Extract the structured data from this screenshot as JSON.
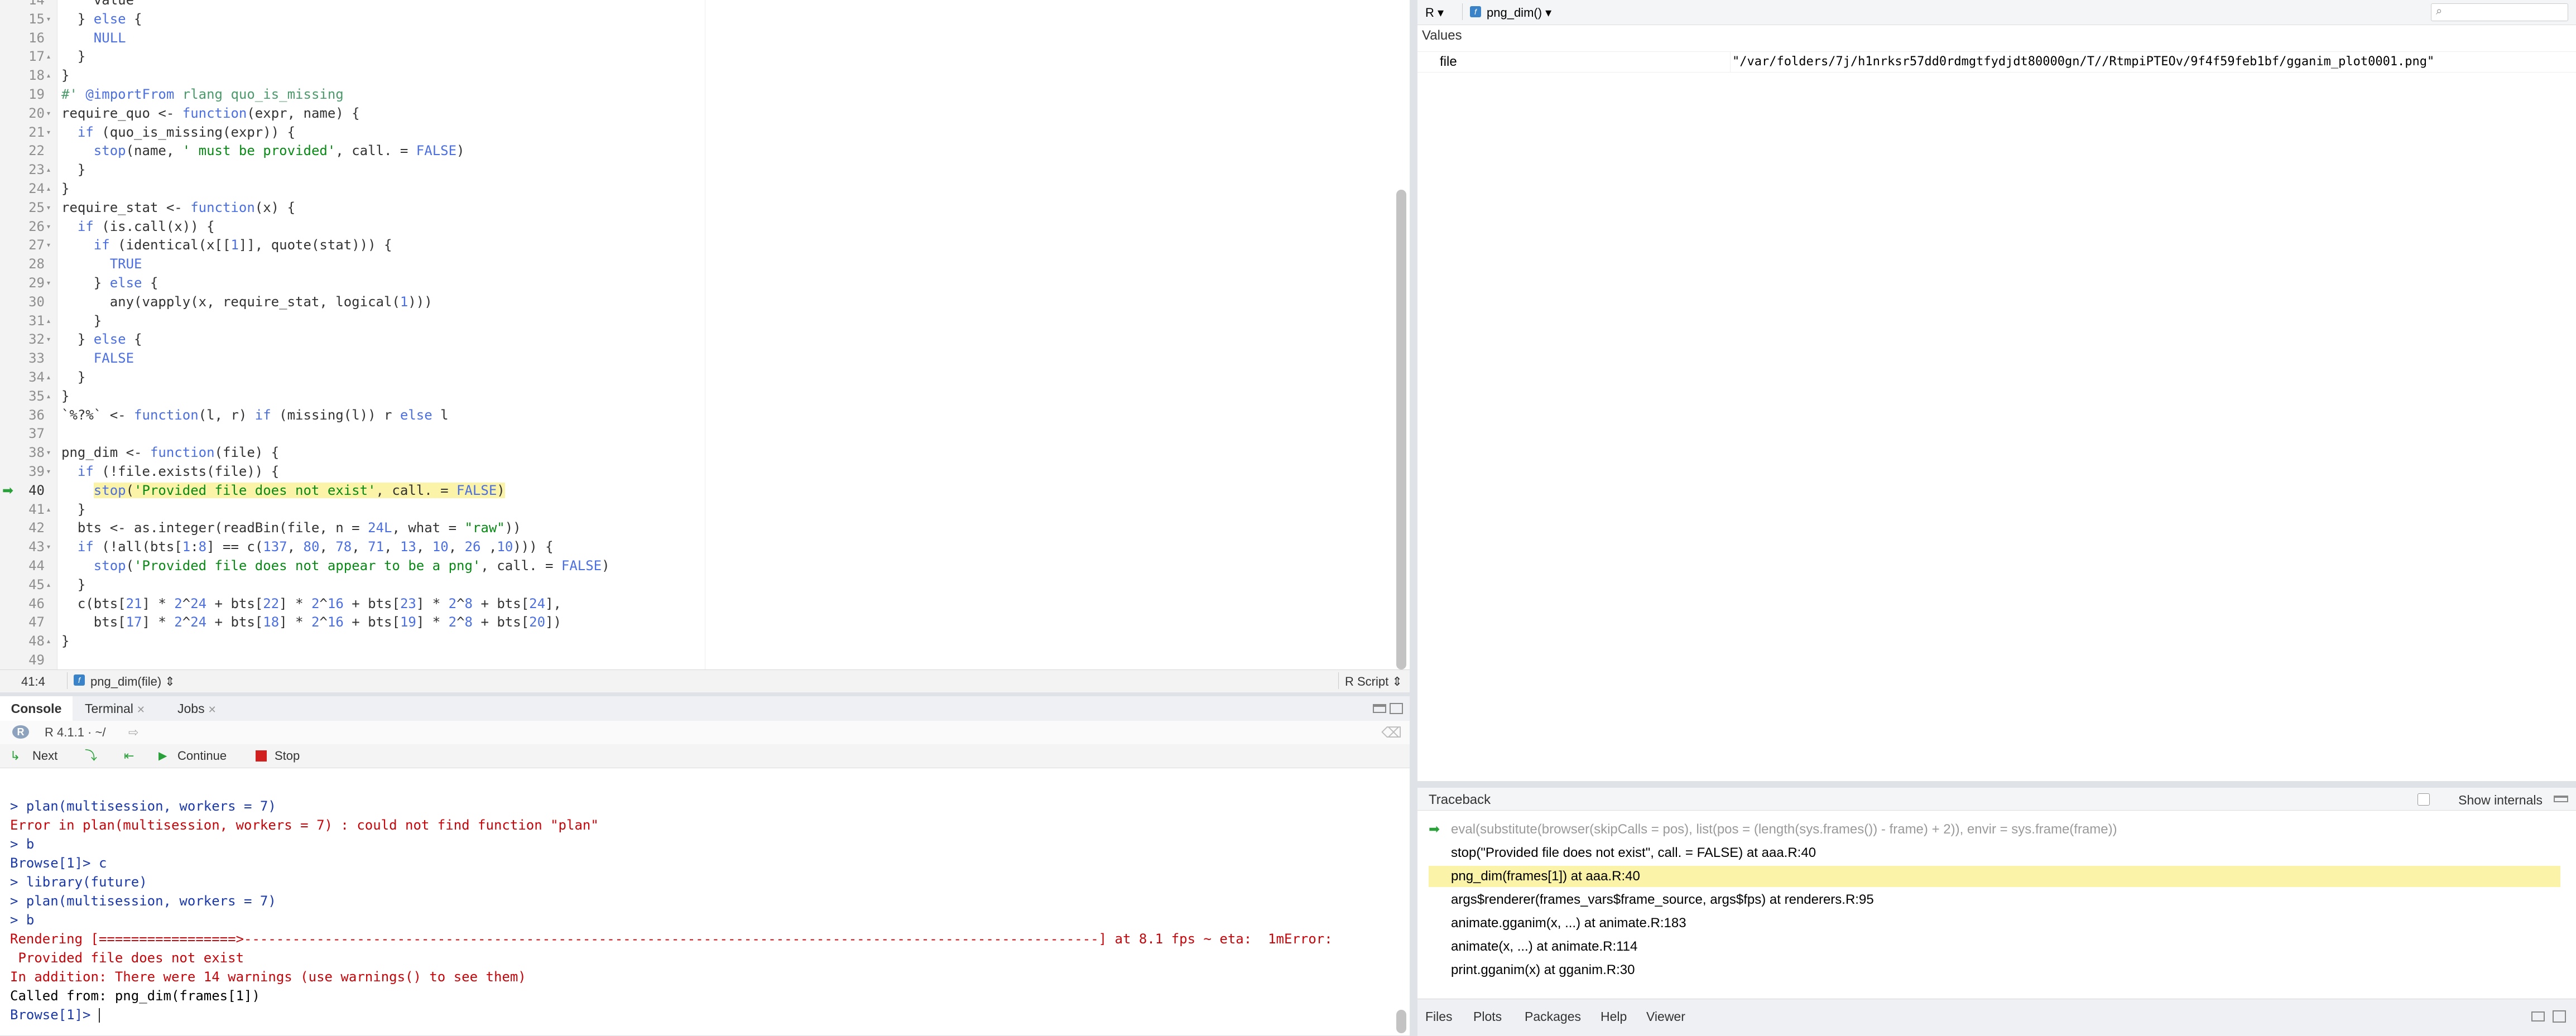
{
  "editor": {
    "lines": [
      {
        "n": "14",
        "fold": "",
        "html": "    value"
      },
      {
        "n": "15",
        "fold": "▾",
        "html": "  } <span class=\"kw\">else</span> {"
      },
      {
        "n": "16",
        "fold": "",
        "html": "    <span class=\"kw\">NULL</span>"
      },
      {
        "n": "17",
        "fold": "▴",
        "html": "  }"
      },
      {
        "n": "18",
        "fold": "▴",
        "html": "}"
      },
      {
        "n": "19",
        "fold": "",
        "html": "<span class=\"cmt\">#' </span><span class=\"kw\">@importFrom</span><span class=\"cmt\"> rlang quo_is_missing</span>"
      },
      {
        "n": "20",
        "fold": "▾",
        "html": "require_quo <- <span class=\"kw\">function</span>(expr, name) {"
      },
      {
        "n": "21",
        "fold": "▾",
        "html": "  <span class=\"kw\">if</span> (quo_is_missing(expr)) {"
      },
      {
        "n": "22",
        "fold": "",
        "html": "    <span class=\"kw\">stop</span>(name, <span class=\"str\">' must be provided'</span>, call. = <span class=\"kw\">FALSE</span>)"
      },
      {
        "n": "23",
        "fold": "▴",
        "html": "  }"
      },
      {
        "n": "24",
        "fold": "▴",
        "html": "}"
      },
      {
        "n": "25",
        "fold": "▾",
        "html": "require_stat <- <span class=\"kw\">function</span>(x) {"
      },
      {
        "n": "26",
        "fold": "▾",
        "html": "  <span class=\"kw\">if</span> (is.call(x)) {"
      },
      {
        "n": "27",
        "fold": "▾",
        "html": "    <span class=\"kw\">if</span> (identical(x[[<span class=\"num\">1</span>]], quote(stat))) {"
      },
      {
        "n": "28",
        "fold": "",
        "html": "      <span class=\"kw\">TRUE</span>"
      },
      {
        "n": "29",
        "fold": "▾",
        "html": "    } <span class=\"kw\">else</span> {"
      },
      {
        "n": "30",
        "fold": "",
        "html": "      any(vapply(x, require_stat, logical(<span class=\"num\">1</span>)))"
      },
      {
        "n": "31",
        "fold": "▴",
        "html": "    }"
      },
      {
        "n": "32",
        "fold": "▾",
        "html": "  } <span class=\"kw\">else</span> {"
      },
      {
        "n": "33",
        "fold": "",
        "html": "    <span class=\"kw\">FALSE</span>"
      },
      {
        "n": "34",
        "fold": "▴",
        "html": "  }"
      },
      {
        "n": "35",
        "fold": "▴",
        "html": "}"
      },
      {
        "n": "36",
        "fold": "",
        "html": "`%?%` <- <span class=\"kw\">function</span>(l, r) <span class=\"kw\">if</span> (missing(l)) r <span class=\"kw\">else</span> l"
      },
      {
        "n": "37",
        "fold": "",
        "html": ""
      },
      {
        "n": "38",
        "fold": "▾",
        "html": "png_dim <- <span class=\"kw\">function</span>(file) {"
      },
      {
        "n": "39",
        "fold": "▾",
        "html": "  <span class=\"kw\">if</span> (!file.exists(file)) {"
      },
      {
        "n": "40",
        "fold": "",
        "html": "    <span class=\"hl\"><span class=\"kw\">stop</span>(<span class=\"str\">'Provided file does not exist'</span>, call. = <span class=\"kw\">FALSE</span>)</span>",
        "current": true
      },
      {
        "n": "41",
        "fold": "▴",
        "html": "  }"
      },
      {
        "n": "42",
        "fold": "",
        "html": "  bts <- as.integer(readBin(file, n = <span class=\"num\">24L</span>, what = <span class=\"str\">\"raw\"</span>))"
      },
      {
        "n": "43",
        "fold": "▾",
        "html": "  <span class=\"kw\">if</span> (!all(bts[<span class=\"num\">1</span>:<span class=\"num\">8</span>] == c(<span class=\"num\">137</span>, <span class=\"num\">80</span>, <span class=\"num\">78</span>, <span class=\"num\">71</span>, <span class=\"num\">13</span>, <span class=\"num\">10</span>, <span class=\"num\">26</span> ,<span class=\"num\">10</span>))) {"
      },
      {
        "n": "44",
        "fold": "",
        "html": "    <span class=\"kw\">stop</span>(<span class=\"str\">'Provided file does not appear to be a png'</span>, call. = <span class=\"kw\">FALSE</span>)"
      },
      {
        "n": "45",
        "fold": "▴",
        "html": "  }"
      },
      {
        "n": "46",
        "fold": "",
        "html": "  c(bts[<span class=\"num\">21</span>] * <span class=\"num\">2</span>^<span class=\"num\">24</span> + bts[<span class=\"num\">22</span>] * <span class=\"num\">2</span>^<span class=\"num\">16</span> + bts[<span class=\"num\">23</span>] * <span class=\"num\">2</span>^<span class=\"num\">8</span> + bts[<span class=\"num\">24</span>],"
      },
      {
        "n": "47",
        "fold": "",
        "html": "    bts[<span class=\"num\">17</span>] * <span class=\"num\">2</span>^<span class=\"num\">24</span> + bts[<span class=\"num\">18</span>] * <span class=\"num\">2</span>^<span class=\"num\">16</span> + bts[<span class=\"num\">19</span>] * <span class=\"num\">2</span>^<span class=\"num\">8</span> + bts[<span class=\"num\">20</span>])"
      },
      {
        "n": "48",
        "fold": "▴",
        "html": "}"
      },
      {
        "n": "49",
        "fold": "",
        "html": ""
      }
    ],
    "status": {
      "position": "41:4",
      "function": "png_dim(file) ⇕",
      "filetype": "R Script ⇕"
    }
  },
  "console": {
    "tabs": [
      {
        "label": "Console",
        "active": true,
        "closable": false
      },
      {
        "label": "Terminal",
        "active": false,
        "closable": true
      },
      {
        "label": "Jobs",
        "active": false,
        "closable": true
      }
    ],
    "version": "R 4.1.1 · ~/",
    "debug": {
      "next": "Next",
      "continue": "Continue",
      "stop": "Stop"
    },
    "lines": [
      {
        "text": "> plan(multisession, workers = 7)",
        "cls": "prm"
      },
      {
        "text": "Error in plan(multisession, workers = 7) : could not find function \"plan\"",
        "cls": "err"
      },
      {
        "text": "> b",
        "cls": "prm"
      },
      {
        "text": "Browse[1]> c",
        "cls": "prm"
      },
      {
        "text": "> library(future)",
        "cls": "prm"
      },
      {
        "text": "> plan(multisession, workers = 7)",
        "cls": "prm"
      },
      {
        "text": "> b",
        "cls": "prm"
      },
      {
        "text": "Rendering [=================>----------------------------------------------------------------------------------------------------------] at 8.1 fps ~ eta:  1mError:",
        "cls": "err"
      },
      {
        "text": " Provided file does not exist",
        "cls": "err"
      },
      {
        "text": "In addition: There were 14 warnings (use warnings() to see them)",
        "cls": "err"
      },
      {
        "text": "Called from: png_dim(frames[1])",
        "cls": ""
      },
      {
        "text": "Browse[1]> ",
        "cls": "prm"
      }
    ]
  },
  "env": {
    "lang": "R ▾",
    "function": "png_dim() ▾",
    "search_placeholder": "",
    "section": "Values",
    "rows": [
      {
        "name": "file",
        "value": "\"/var/folders/7j/h1nrksr57dd0rdmgtfydjdt80000gn/T//RtmpiPTEOv/9f4f59feb1bf/gganim_plot0001.png\""
      }
    ]
  },
  "traceback": {
    "title": "Traceback",
    "show_internals": "Show internals",
    "frames": [
      {
        "text": "eval(substitute(browser(skipCalls = pos), list(pos = (length(sys.frames()) - frame) + 2)), envir = sys.frame(frame))",
        "state": "internal"
      },
      {
        "text": "stop(\"Provided file does not exist\", call. = FALSE) at aaa.R:40",
        "state": "normal"
      },
      {
        "text": "png_dim(frames[1]) at aaa.R:40",
        "state": "selected"
      },
      {
        "text": "args$renderer(frames_vars$frame_source, args$fps) at renderers.R:95",
        "state": "normal"
      },
      {
        "text": "animate.gganim(x, ...) at animate.R:183",
        "state": "normal"
      },
      {
        "text": "animate(x, ...) at animate.R:114",
        "state": "normal"
      },
      {
        "text": "print.gganim(x) at gganim.R:30",
        "state": "normal"
      }
    ]
  },
  "files": {
    "tabs": [
      "Files",
      "Plots",
      "Packages",
      "Help",
      "Viewer"
    ]
  },
  "colors": {
    "accent": "#4b6fe0",
    "error": "#c5060b",
    "highlight": "#fbf3a7",
    "debug_arrow": "#2aa03a"
  }
}
